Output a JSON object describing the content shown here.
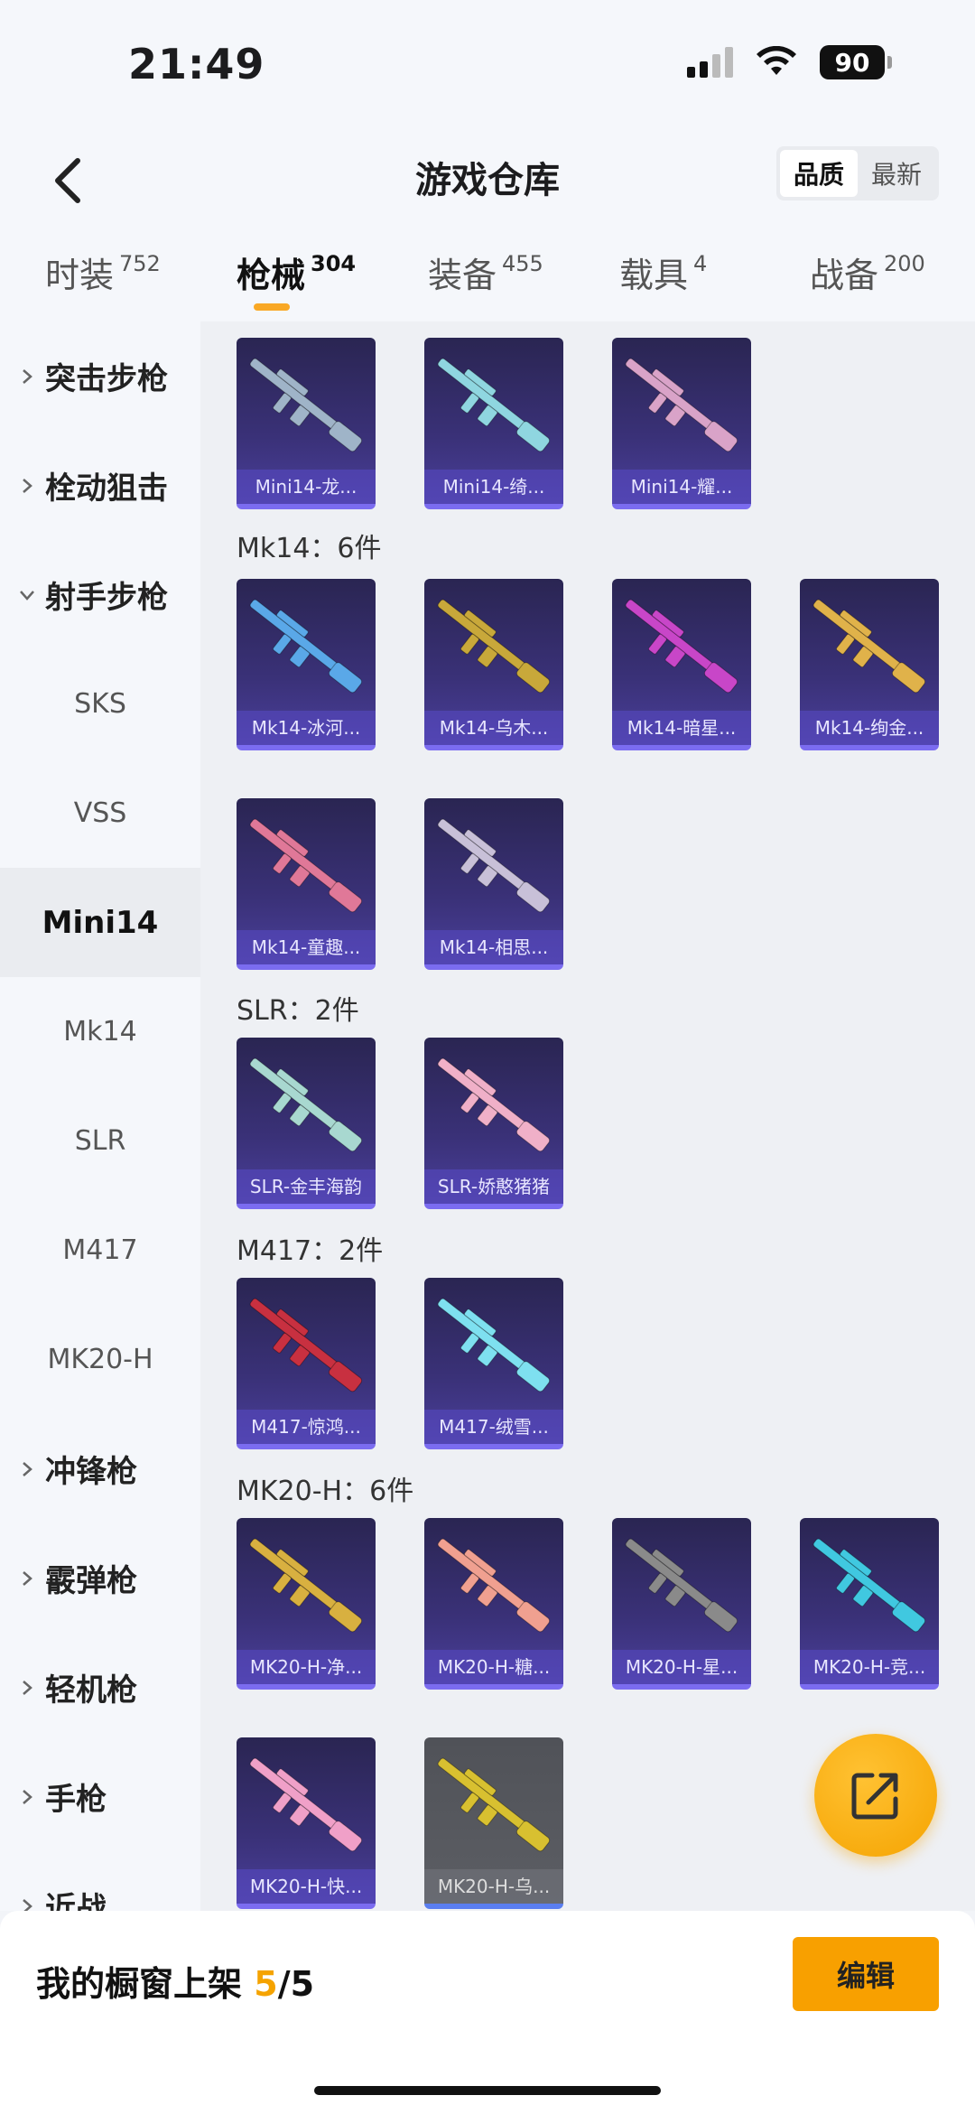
{
  "status": {
    "time": "21:49",
    "battery": "90"
  },
  "header": {
    "title": "游戏仓库",
    "sort_quality": "品质",
    "sort_newest": "最新"
  },
  "tabs": [
    {
      "label": "时装",
      "count": "752"
    },
    {
      "label": "枪械",
      "count": "304"
    },
    {
      "label": "装备",
      "count": "455"
    },
    {
      "label": "载具",
      "count": "4"
    },
    {
      "label": "战备",
      "count": "200"
    }
  ],
  "sidebar": [
    {
      "label": "突击步枪"
    },
    {
      "label": "栓动狙击"
    },
    {
      "label": "射手步枪"
    },
    {
      "label": "SKS"
    },
    {
      "label": "VSS"
    },
    {
      "label": "Mini14"
    },
    {
      "label": "Mk14"
    },
    {
      "label": "SLR"
    },
    {
      "label": "M417"
    },
    {
      "label": "MK20-H"
    },
    {
      "label": "冲锋枪"
    },
    {
      "label": "霰弹枪"
    },
    {
      "label": "轻机枪"
    },
    {
      "label": "手枪"
    },
    {
      "label": "近战"
    }
  ],
  "sections": {
    "mk14": "Mk14：6件",
    "slr": "SLR：2件",
    "m417": "M417：2件",
    "mk20h": "MK20-H：6件"
  },
  "items": {
    "mini14": [
      "Mini14-龙...",
      "Mini14-绮...",
      "Mini14-耀..."
    ],
    "mk14": [
      "Mk14-冰河...",
      "Mk14-乌木...",
      "Mk14-暗星...",
      "Mk14-绚金...",
      "Mk14-童趣...",
      "Mk14-相思..."
    ],
    "slr": [
      "SLR-金丰海韵",
      "SLR-娇憨猪猪"
    ],
    "m417": [
      "M417-惊鸿...",
      "M417-绒雪..."
    ],
    "mk20h": [
      "MK20-H-净...",
      "MK20-H-糖...",
      "MK20-H-星...",
      "MK20-H-竞...",
      "MK20-H-快...",
      "MK20-H-乌..."
    ]
  },
  "icons": {
    "back": "chevron-left-icon",
    "share": "share-external-icon"
  },
  "colors": {
    "accent": "#f5a300",
    "card_bg": "#3a3178"
  },
  "bottom": {
    "prefix": "我的橱窗上架 ",
    "current": "5",
    "total": "/5",
    "edit_label": "编辑"
  }
}
